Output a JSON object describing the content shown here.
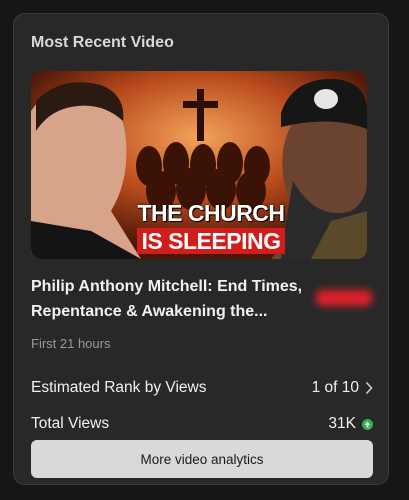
{
  "card": {
    "title": "Most Recent Video",
    "thumbnail": {
      "headline_line1": "THE CHURCH",
      "headline_line2": "IS SLEEPING"
    },
    "video_title": "Philip Anthony Mitchell: End Times, Repentance & Awakening the...",
    "time_window": "First 21 hours",
    "rank": {
      "label": "Estimated Rank by Views",
      "value": "1 of 10"
    },
    "views": {
      "label": "Total Views",
      "value": "31K"
    },
    "button_label": "More video analytics"
  },
  "colors": {
    "accent_green": "#2fb34a",
    "headline_red": "#d21d1d",
    "card_bg": "#282828"
  }
}
